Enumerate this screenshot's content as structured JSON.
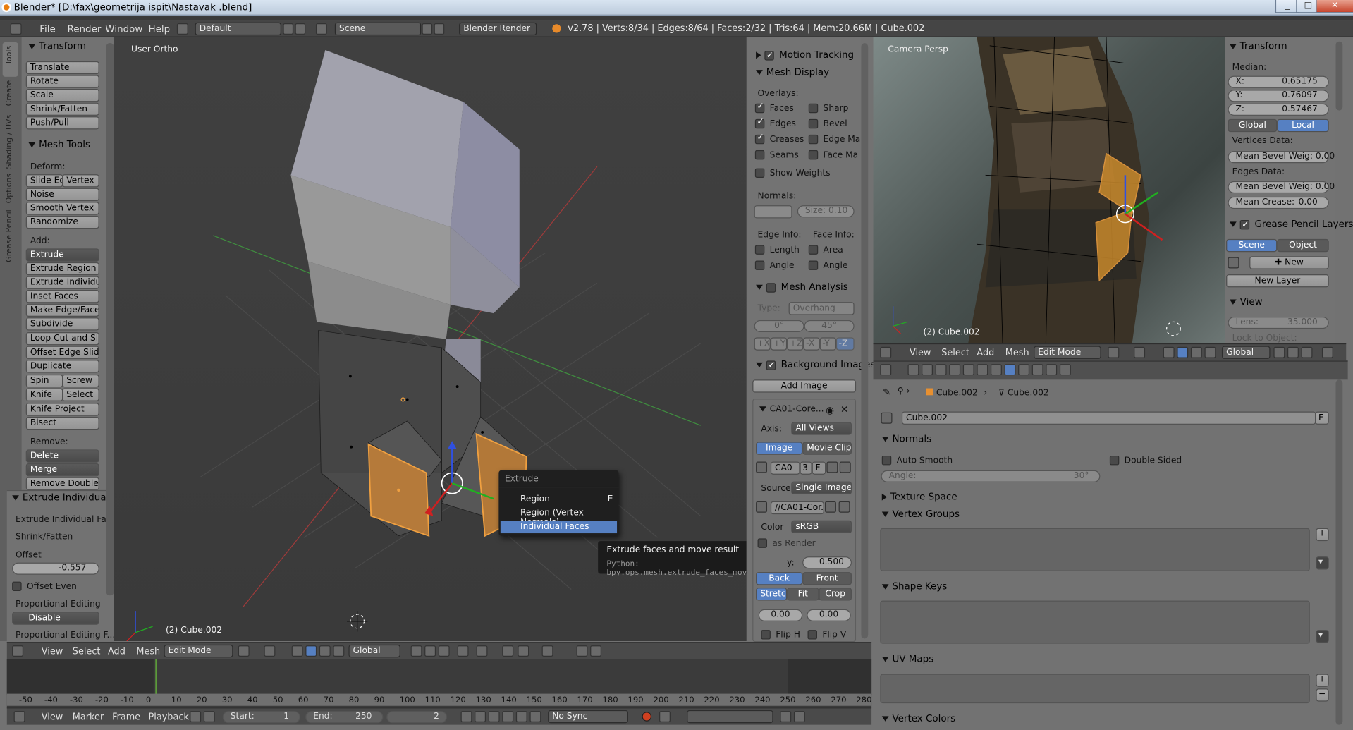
{
  "window": {
    "title": "Blender* [D:\\fax\\geometrija ispit\\Nastavak .blend]",
    "min": "_",
    "max": "□",
    "close": "✕"
  },
  "topbar": {
    "menus": [
      "File",
      "Render",
      "Window",
      "Help"
    ],
    "layout": "Default",
    "scene": "Scene",
    "engine": "Blender Render",
    "stats": "v2.78 | Verts:8/34 | Edges:8/64 | Faces:2/32 | Tris:64 | Mem:20.66M | Cube.002"
  },
  "toolshelf": {
    "tabs": [
      "Tools",
      "Create",
      "Shading / UVs",
      "Options",
      "Grease Pencil"
    ],
    "transform_title": "Transform",
    "transform": [
      "Translate",
      "Rotate",
      "Scale",
      "Shrink/Fatten",
      "Push/Pull"
    ],
    "mesh_tools_title": "Mesh Tools",
    "deform_label": "Deform:",
    "slide_edge": "Slide Ed",
    "vertex": "Vertex",
    "noise": "Noise",
    "smooth_vertex": "Smooth Vertex",
    "randomize": "Randomize",
    "add_label": "Add:",
    "extrude": "Extrude",
    "extrude_region": "Extrude Region",
    "extrude_individual": "Extrude Individual",
    "inset_faces": "Inset Faces",
    "make_edge_face": "Make Edge/Face",
    "subdivide": "Subdivide",
    "loop_cut": "Loop Cut and Slide",
    "offset_edge": "Offset Edge Slide",
    "duplicate": "Duplicate",
    "spin": "Spin",
    "screw": "Screw",
    "knife": "Knife",
    "select": "Select",
    "knife_project": "Knife Project",
    "bisect": "Bisect",
    "remove_label": "Remove:",
    "delete": "Delete",
    "merge": "Merge",
    "remove_doubles": "Remove Doubles"
  },
  "operator": {
    "title": "Extrude Individual Fa",
    "name": "Extrude Individual Fac...",
    "shrink": "Shrink/Fatten",
    "offset_label": "Offset",
    "offset_value": "-0.557",
    "offset_even": "Offset Even",
    "prop_label": "Proportional Editing",
    "prop_value": "Disable",
    "prop_falloff": "Proportional Editing F..."
  },
  "viewport": {
    "label": "User Ortho",
    "object": "(2) Cube.002"
  },
  "vp_header": {
    "menus": [
      "View",
      "Select",
      "Add",
      "Mesh"
    ],
    "mode": "Edit Mode",
    "orientation": "Global"
  },
  "popup": {
    "title": "Extrude",
    "items": [
      {
        "label": "Region",
        "key": "E"
      },
      {
        "label": "Region (Vertex Normals)",
        "key": ""
      },
      {
        "label": "Individual Faces",
        "key": ""
      }
    ]
  },
  "tooltip": {
    "text": "Extrude faces and move result",
    "python": "Python: bpy.ops.mesh.extrude_faces_move()"
  },
  "npanel": {
    "motion_tracking": "Motion Tracking",
    "mesh_display": "Mesh Display",
    "overlays": "Overlays:",
    "faces": "Faces",
    "sharp": "Sharp",
    "edges": "Edges",
    "bevel": "Bevel",
    "creases": "Creases",
    "edge_marks": "Edge Ma",
    "seams": "Seams",
    "face_marks": "Face Ma",
    "show_weights": "Show Weights",
    "normals": "Normals:",
    "size": "Size:  0.10",
    "edge_info": "Edge Info:",
    "face_info": "Face Info:",
    "length": "Length",
    "area": "Area",
    "angle": "Angle",
    "angle2": "Angle",
    "mesh_analysis": "Mesh Analysis",
    "type_label": "Type:",
    "type_value": "Overhang",
    "min": "0°",
    "max": "45°",
    "axes": [
      "+X",
      "+Y",
      "+Z",
      "-X",
      "-Y",
      "-Z"
    ],
    "bg_images": "Background Images",
    "add_image": "Add Image",
    "img_name": "CA01-Core...",
    "axis_label": "Axis:",
    "axis_value": "All Views",
    "image": "Image",
    "movie_clip": "Movie Clip",
    "ca0": "CA0",
    "n3": "3",
    "f": "F",
    "source_label": "Source",
    "source_value": "Single Image",
    "path": "//CA01-Cor...",
    "color_label": "Color",
    "color_value": "sRGB",
    "as_render": "as Render",
    "opacity": "0.500",
    "opacity_label": "y:",
    "back": "Back",
    "front": "Front",
    "stretch": "Stretch",
    "fit": "Fit",
    "crop": "Crop",
    "ox": "0.00",
    "oy": "0.00",
    "fliph": "Flip H",
    "flipv": "Flip V"
  },
  "camera": {
    "label": "Camera Persp",
    "object": "(2) Cube.002"
  },
  "cam_header": {
    "menus": [
      "View",
      "Select",
      "Add",
      "Mesh"
    ],
    "mode": "Edit Mode",
    "orientation": "Global"
  },
  "rpanel": {
    "transform": "Transform",
    "median": "Median:",
    "x": "X:",
    "xv": "0.65175",
    "y": "Y:",
    "yv": "0.76097",
    "z": "Z:",
    "zv": "-0.57467",
    "global": "Global",
    "local": "Local",
    "verts_data": "Vertices Data:",
    "mbw": "Mean Bevel Weig: 0.00",
    "edges_data": "Edges Data:",
    "mbw2": "Mean Bevel Weig: 0.00",
    "crease": "Mean Crease:",
    "crease_v": "0.00",
    "gp_layers": "Grease Pencil Layers",
    "scene": "Scene",
    "object": "Object",
    "new": "New",
    "new_layer": "New Layer",
    "view": "View",
    "lens": "Lens:",
    "lens_v": "35.000",
    "lock": "Lock to Object:"
  },
  "props": {
    "breadcrumb1": "Cube.002",
    "breadcrumb2": "Cube.002",
    "name": "Cube.002",
    "f": "F",
    "normals": "Normals",
    "auto_smooth": "Auto Smooth",
    "double_sided": "Double Sided",
    "angle": "Angle:",
    "angle_v": "30°",
    "texture_space": "Texture Space",
    "vertex_groups": "Vertex Groups",
    "shape_keys": "Shape Keys",
    "uv_maps": "UV Maps",
    "vertex_colors": "Vertex Colors"
  },
  "timeline": {
    "ticks": [
      "-50",
      "-40",
      "-30",
      "-20",
      "-10",
      "0",
      "10",
      "20",
      "30",
      "40",
      "50",
      "60",
      "70",
      "80",
      "90",
      "100",
      "110",
      "120",
      "130",
      "140",
      "150",
      "160",
      "170",
      "180",
      "190",
      "200",
      "210",
      "220",
      "230",
      "240",
      "250",
      "260",
      "270",
      "280"
    ],
    "menus": [
      "View",
      "Marker",
      "Frame",
      "Playback"
    ],
    "start": "Start:",
    "start_v": "1",
    "end": "End:",
    "end_v": "250",
    "current": "2",
    "sync": "No Sync"
  }
}
